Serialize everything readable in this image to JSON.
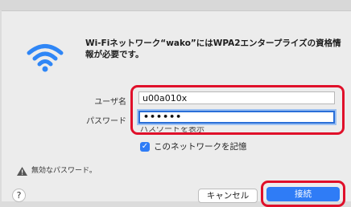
{
  "dialog": {
    "message": "Wi-Fiネットワーク“wako”にはWPA2エンタープライズの資格情報が必要です。"
  },
  "form": {
    "username_label": "ユーザ名",
    "username_value": "u00a010x",
    "password_label": "パスワード",
    "password_value": "••••••",
    "show_password_label": "パスワードを表示",
    "remember_label": "このネットワークを記憶",
    "remember_checked": true
  },
  "warning": {
    "label": "無効なパスワード。"
  },
  "buttons": {
    "help_label": "?",
    "cancel_label": "キャンセル",
    "connect_label": "接続"
  },
  "icons": {
    "wifi": "wifi-icon",
    "warning": "warning-triangle-icon",
    "check": "checkmark-icon"
  },
  "colors": {
    "accent": "#2f7cf6",
    "highlight_outline": "#e0102a"
  }
}
